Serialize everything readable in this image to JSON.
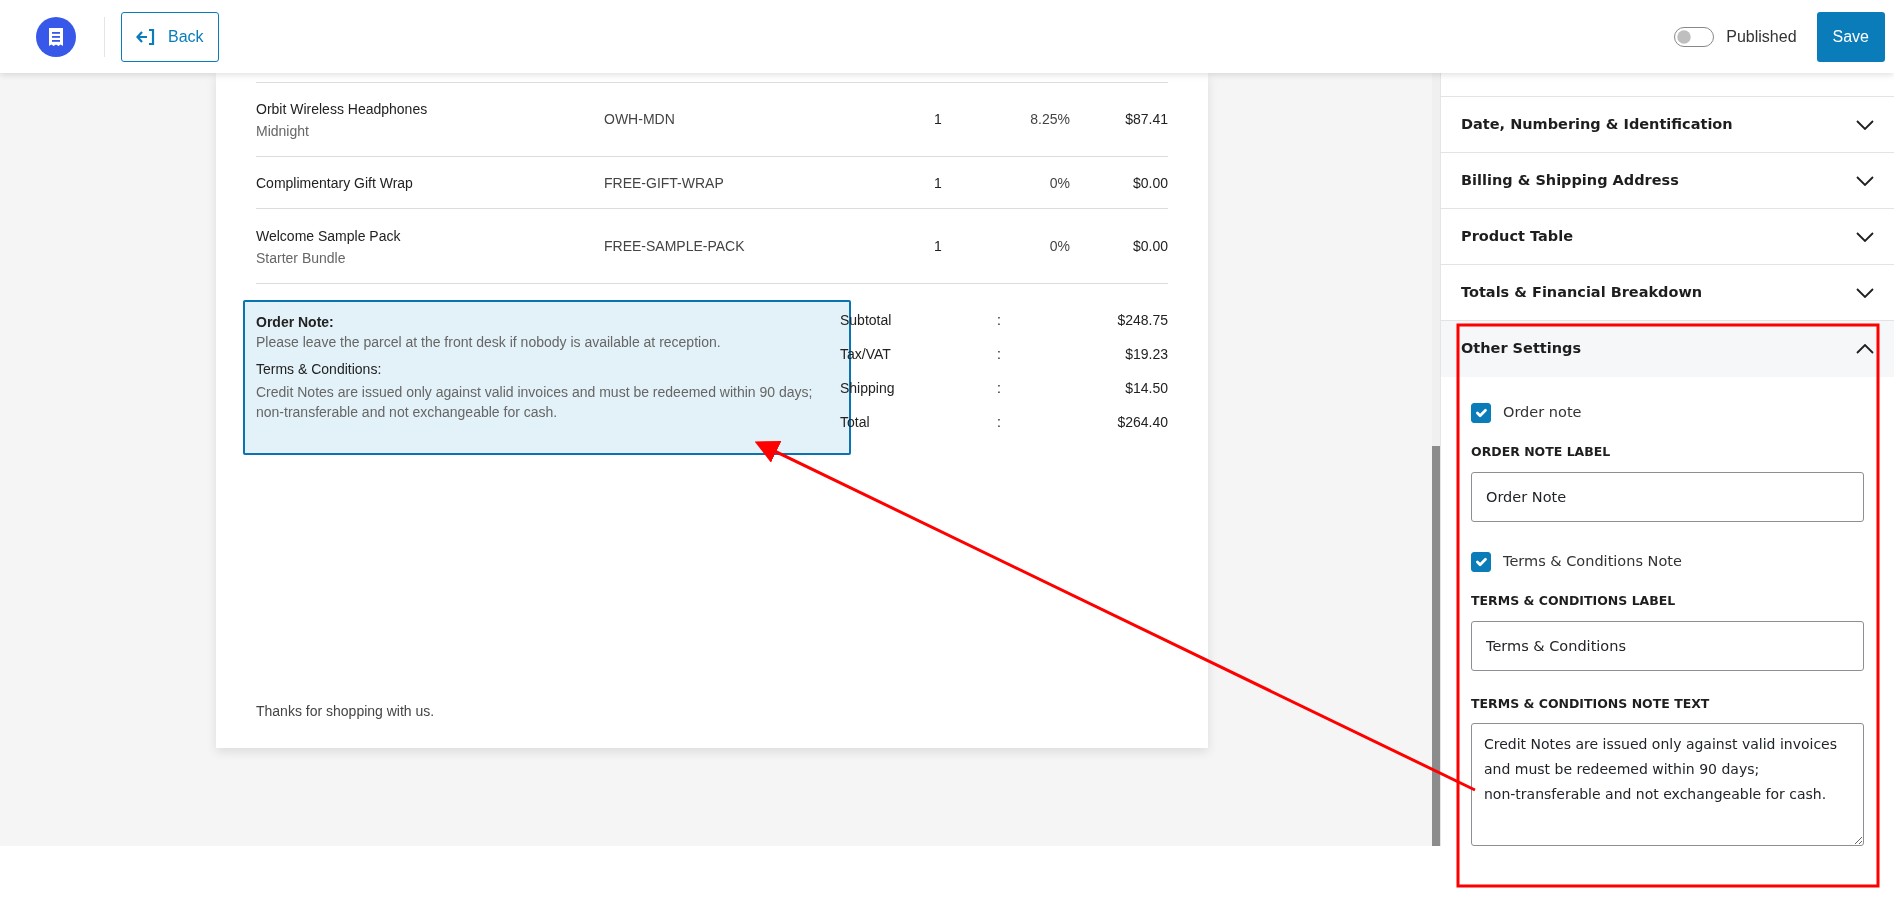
{
  "header": {
    "back_button": {
      "label": "Back"
    },
    "publish_toggle": {
      "label": "Published",
      "on": false
    },
    "save_button": {
      "label": "Save"
    }
  },
  "invoice": {
    "rows": [
      {
        "name": "Orbit Wireless Headphones",
        "variant": "Midnight",
        "sku": "OWH-MDN",
        "qty": "1",
        "tax": "8.25%",
        "total": "$87.41"
      },
      {
        "name": "Complimentary Gift Wrap",
        "sku": "FREE-GIFT-WRAP",
        "qty": "1",
        "tax": "0%",
        "total": "$0.00"
      },
      {
        "name": "Welcome Sample Pack",
        "variant": "Starter Bundle",
        "sku": "FREE-SAMPLE-PACK",
        "qty": "1",
        "tax": "0%",
        "total": "$0.00"
      }
    ],
    "notes": {
      "order_note_label": "Order Note:",
      "order_note_text": "Please leave the parcel at the front desk if nobody is available at reception.",
      "terms_label": "Terms & Conditions:",
      "terms_text": "Credit Notes are issued only against valid invoices and must be redeemed within 90 days;\nnon-transferable and not exchangeable for cash."
    },
    "totals": [
      {
        "label": "Subtotal",
        "separator": ":",
        "value": "$248.75"
      },
      {
        "label": "Tax/VAT",
        "separator": ":",
        "value": "$19.23"
      },
      {
        "label": "Shipping",
        "separator": ":",
        "value": "$14.50"
      },
      {
        "label": "Total",
        "separator": ":",
        "value": "$264.40"
      }
    ],
    "footer": "Thanks for shopping with us."
  },
  "settings_panel": {
    "sections": [
      {
        "title": "Date, Numbering & Identification",
        "expanded": false
      },
      {
        "title": "Billing & Shipping Address",
        "expanded": false
      },
      {
        "title": "Product Table",
        "expanded": false
      },
      {
        "title": "Totals & Financial Breakdown",
        "expanded": false
      },
      {
        "title": "Other Settings",
        "expanded": true,
        "fields": [
          {
            "kind": "checkbox",
            "label": "Order note",
            "checked": true
          },
          {
            "kind": "text",
            "label": "ORDER NOTE LABEL",
            "value": "Order Note"
          },
          {
            "kind": "checkbox",
            "label": "Terms & Conditions Note",
            "checked": true
          },
          {
            "kind": "text",
            "label": "TERMS & CONDITIONS LABEL",
            "value": "Terms & Conditions"
          },
          {
            "kind": "textarea",
            "label": "TERMS & CONDITIONS NOTE TEXT",
            "value": "Credit Notes are issued only against valid invoices and must be redeemed within 90 days;\nnon-transferable and not exchangeable for cash."
          }
        ]
      }
    ]
  }
}
